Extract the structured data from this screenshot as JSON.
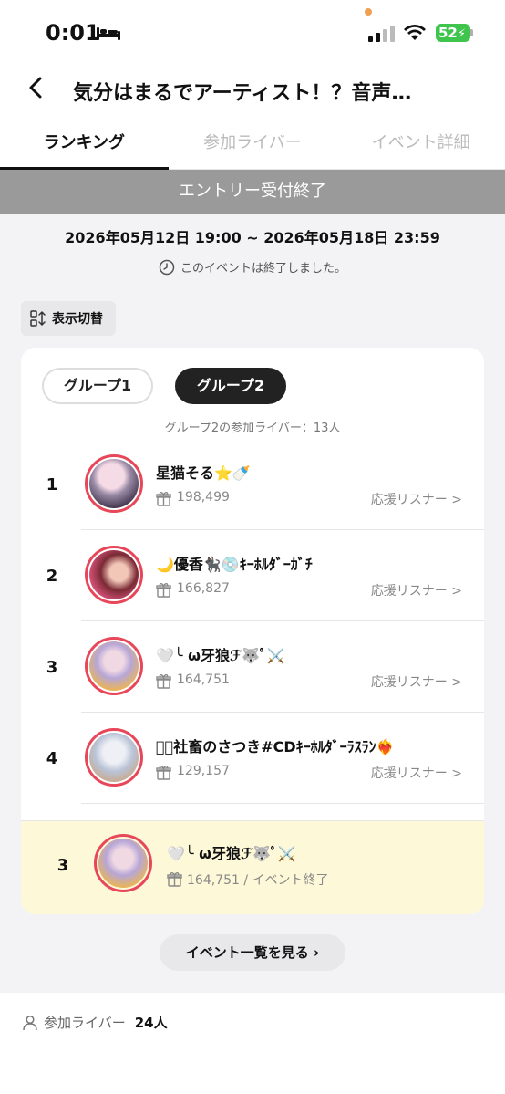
{
  "status": {
    "time": "0:01",
    "battery": "52"
  },
  "header": {
    "title": "気分はまるでアーティスト！？音声…"
  },
  "tabs": [
    {
      "label": "ランキング"
    },
    {
      "label": "参加ライバー"
    },
    {
      "label": "イベント詳細"
    }
  ],
  "banner": "エントリー受付終了",
  "period": "2026年05月12日 19:00 ~ 2026年05月18日 23:59",
  "ended_notice": "このイベントは終了しました。",
  "toggle_label": "表示切替",
  "groups": [
    {
      "label": "グループ1"
    },
    {
      "label": "グループ2"
    }
  ],
  "group_count": "グループ2の参加ライバー：13人",
  "ranking": [
    {
      "rank": "1",
      "name": "星猫そる⭐️🍼",
      "points": "198,499",
      "support": "応援リスナー >"
    },
    {
      "rank": "2",
      "name": "🌙優香🐈‍⬛💿ｷｰﾎﾙﾀﾞｰｶﾞﾁ",
      "points": "166,827",
      "support": "応援リスナー >"
    },
    {
      "rank": "3",
      "name": "🤍╰ ω牙狼ℱ🐺ﾟ⚔️",
      "points": "164,751",
      "support": "応援リスナー >"
    },
    {
      "rank": "4",
      "name": "𝓢ﾟ社畜のさつき#CDｷｰﾎﾙﾀﾞｰﾗｽﾗﾝ❤️‍🔥",
      "points": "129,157",
      "support": "応援リスナー >"
    }
  ],
  "my_entry": {
    "rank": "3",
    "name": "🤍╰ ω牙狼ℱ🐺ﾟ⚔️",
    "points_status": "164,751 / イベント終了"
  },
  "event_list_button": "イベント一覧を見る  ›",
  "footer": {
    "label": "参加ライバー",
    "count": "24人"
  },
  "colors": {
    "accent": "#e8475a",
    "highlight": "#fdf8d8",
    "banner": "#9a9a9a"
  }
}
